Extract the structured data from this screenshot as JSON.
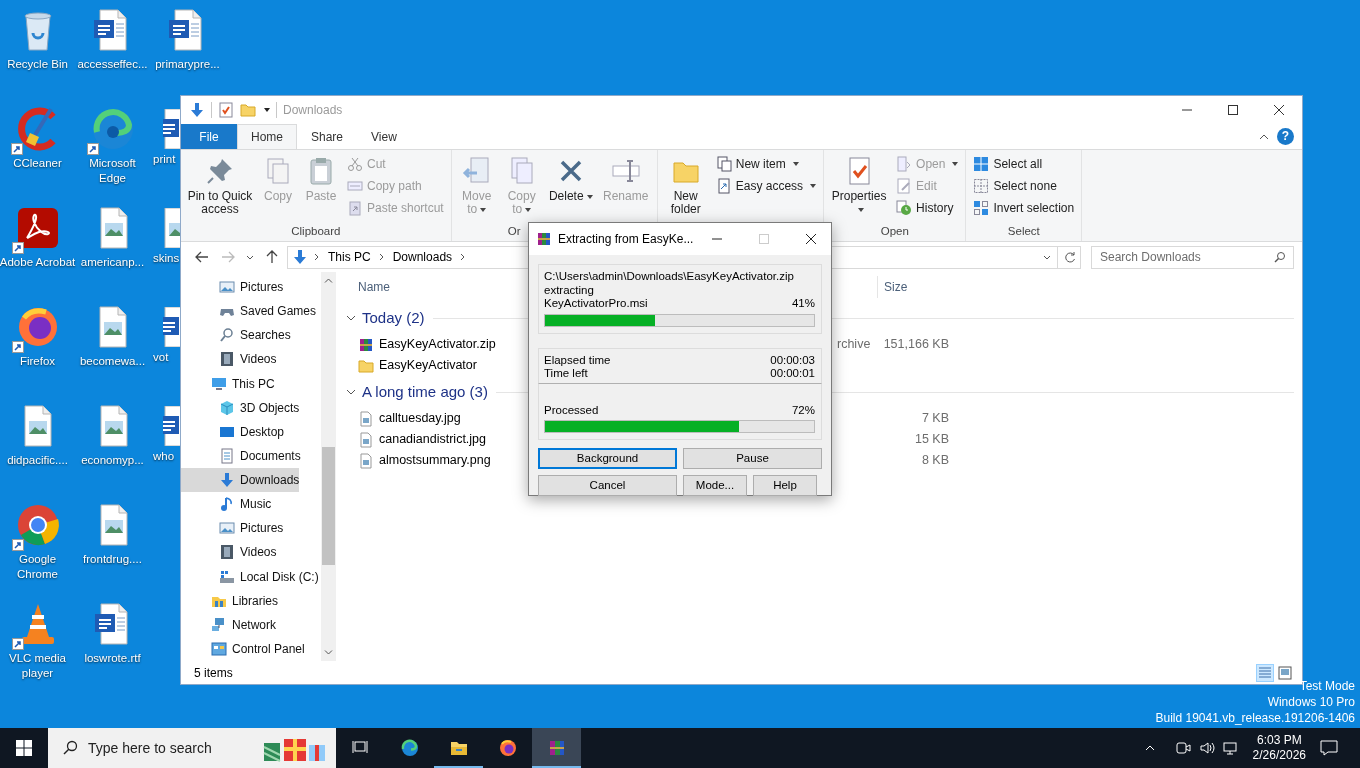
{
  "desktop": {
    "icons": [
      {
        "label": "Recycle Bin",
        "kind": "bin",
        "shortcut": false
      },
      {
        "label": "CCleaner",
        "kind": "ccleaner",
        "shortcut": true
      },
      {
        "label": "Adobe Acrobat",
        "kind": "acrobat",
        "shortcut": true
      },
      {
        "label": "Firefox",
        "kind": "firefox",
        "shortcut": true
      },
      {
        "label": "didpacific....",
        "kind": "image",
        "shortcut": false
      },
      {
        "label": "Google Chrome",
        "kind": "chrome",
        "shortcut": true
      },
      {
        "label": "VLC media player",
        "kind": "vlc",
        "shortcut": true
      },
      {
        "label": "accesseffec...",
        "kind": "word",
        "shortcut": false
      },
      {
        "label": "Microsoft Edge",
        "kind": "edge",
        "shortcut": true
      },
      {
        "label": "americanp...",
        "kind": "image",
        "shortcut": false
      },
      {
        "label": "becomewa...",
        "kind": "image",
        "shortcut": false
      },
      {
        "label": "economyp...",
        "kind": "image",
        "shortcut": false
      },
      {
        "label": "frontdrug....",
        "kind": "image",
        "shortcut": false
      },
      {
        "label": "loswrote.rtf",
        "kind": "word",
        "shortcut": false
      },
      {
        "label": "primarypre...",
        "kind": "word",
        "shortcut": false
      },
      {
        "label": "print",
        "kind": "word",
        "shortcut": false
      },
      {
        "label": "skins",
        "kind": "image",
        "shortcut": false
      },
      {
        "label": "vot",
        "kind": "word",
        "shortcut": false
      },
      {
        "label": "who",
        "kind": "word",
        "shortcut": false
      }
    ],
    "system_text": [
      "Test Mode",
      "Windows 10 Pro",
      "Build 19041.vb_release.191206-1406"
    ]
  },
  "explorer": {
    "title": "Downloads",
    "ribbon": {
      "tabs": [
        {
          "label": "File",
          "kind": "file",
          "selected": false
        },
        {
          "label": "Home",
          "kind": "tab",
          "selected": true
        },
        {
          "label": "Share",
          "kind": "tab",
          "selected": false
        },
        {
          "label": "View",
          "kind": "tab",
          "selected": false
        }
      ],
      "help": "?",
      "groups": [
        {
          "label": "Clipboard",
          "items": [
            {
              "label": "Pin to Quick access",
              "kind": "large",
              "disabled": false,
              "dropdown": false
            },
            {
              "label": "Copy",
              "kind": "large",
              "disabled": true,
              "dropdown": false
            },
            {
              "label": "Paste",
              "kind": "large",
              "disabled": true,
              "dropdown": false
            },
            {
              "label": "Cut",
              "kind": "small",
              "disabled": true,
              "dropdown": false
            },
            {
              "label": "Copy path",
              "kind": "small",
              "disabled": true,
              "dropdown": false
            },
            {
              "label": "Paste shortcut",
              "kind": "small",
              "disabled": true,
              "dropdown": false
            }
          ]
        },
        {
          "label": "Or",
          "items": [
            {
              "label": "Move to",
              "kind": "large",
              "disabled": true,
              "dropdown": true
            },
            {
              "label": "Copy to",
              "kind": "large",
              "disabled": true,
              "dropdown": true
            },
            {
              "label": "Delete",
              "kind": "large",
              "disabled": false,
              "dropdown": true
            },
            {
              "label": "Rename",
              "kind": "large",
              "disabled": true,
              "dropdown": false
            }
          ]
        },
        {
          "items": [
            {
              "label": "New folder",
              "kind": "large",
              "disabled": false,
              "dropdown": false
            },
            {
              "label": "New item",
              "kind": "small",
              "disabled": false,
              "dropdown": true
            },
            {
              "label": "Easy access",
              "kind": "small",
              "disabled": false,
              "dropdown": true
            }
          ]
        },
        {
          "label": "Open",
          "items": [
            {
              "label": "Properties",
              "kind": "large",
              "disabled": false,
              "dropdown": true
            },
            {
              "label": "Open",
              "kind": "small",
              "disabled": true,
              "dropdown": true
            },
            {
              "label": "Edit",
              "kind": "small",
              "disabled": true,
              "dropdown": false
            },
            {
              "label": "History",
              "kind": "small",
              "disabled": false,
              "dropdown": false
            }
          ]
        },
        {
          "label": "Select",
          "items": [
            {
              "label": "Select all",
              "kind": "small",
              "disabled": false,
              "dropdown": false
            },
            {
              "label": "Select none",
              "kind": "small",
              "disabled": false,
              "dropdown": false
            },
            {
              "label": "Invert selection",
              "kind": "small",
              "disabled": false,
              "dropdown": false
            }
          ]
        }
      ]
    },
    "address_bar": {
      "path": [
        "This PC",
        "Downloads"
      ]
    },
    "search": {
      "placeholder": "Search Downloads"
    },
    "nav_pane": {
      "continued_children": [
        {
          "label": "Pictures",
          "kind": "pictures",
          "selected": false
        },
        {
          "label": "Saved Games",
          "kind": "games",
          "selected": false
        },
        {
          "label": "Searches",
          "kind": "search",
          "selected": false
        },
        {
          "label": "Videos",
          "kind": "videos",
          "selected": false
        }
      ],
      "items": [
        {
          "label": "This PC",
          "kind": "pc",
          "selected": false,
          "children": [
            {
              "label": "3D Objects",
              "kind": "objects",
              "selected": false
            },
            {
              "label": "Desktop",
              "kind": "desktop",
              "selected": false
            },
            {
              "label": "Documents",
              "kind": "documents",
              "selected": false
            },
            {
              "label": "Downloads",
              "kind": "downloads",
              "selected": true
            },
            {
              "label": "Music",
              "kind": "music",
              "selected": false
            },
            {
              "label": "Pictures",
              "kind": "pictures",
              "selected": false
            },
            {
              "label": "Videos",
              "kind": "videos",
              "selected": false
            },
            {
              "label": "Local Disk (C:)",
              "kind": "disk",
              "selected": false
            }
          ]
        },
        {
          "label": "Libraries",
          "kind": "libraries",
          "selected": false
        },
        {
          "label": "Network",
          "kind": "network",
          "selected": false
        },
        {
          "label": "Control Panel",
          "kind": "control",
          "selected": false
        }
      ]
    },
    "columns": [
      "Name",
      "Size"
    ],
    "groups": [
      {
        "label": "Today (2)",
        "files": [
          {
            "name": "EasyKeyActivator.zip",
            "kind": "archive",
            "type": "rchive",
            "size": "151,166 KB"
          },
          {
            "name": "EasyKeyActivator",
            "kind": "folder"
          }
        ]
      },
      {
        "label": "A long time ago (3)",
        "files": [
          {
            "name": "calltuesday.jpg",
            "kind": "image",
            "size": "7 KB"
          },
          {
            "name": "canadiandistrict.jpg",
            "kind": "image",
            "size": "15 KB"
          },
          {
            "name": "almostsummary.png",
            "kind": "image",
            "size": "8 KB"
          }
        ]
      }
    ],
    "status_bar": {
      "text": "5 items",
      "view_buttons": [
        {
          "kind": "details",
          "selected": true
        },
        {
          "kind": "tiles",
          "selected": false
        }
      ]
    }
  },
  "dialog": {
    "title": "Extracting from EasyKe...",
    "archive_path": "C:\\Users\\admin\\Downloads\\EasyKeyActivator.zip",
    "action": "extracting",
    "current_file": "KeyActivatorPro.msi",
    "file_percent": "41%",
    "file_progress": {
      "level": 0.41
    },
    "stats": [
      {
        "label": "Elapsed time",
        "value": "00:00:03"
      },
      {
        "label": "Time left",
        "value": "00:00:01"
      }
    ],
    "total_label": "Processed",
    "total_percent": "72%",
    "total_progress": {
      "level": 0.72
    },
    "buttons": [
      {
        "label": "Background",
        "default": true
      },
      {
        "label": "Pause",
        "default": false
      },
      {
        "label": "Cancel",
        "default": false
      },
      {
        "label": "Mode...",
        "default": false
      },
      {
        "label": "Help",
        "default": false
      }
    ]
  },
  "taskbar": {
    "search": {
      "placeholder": "Type here to search"
    },
    "apps": [
      {
        "kind": "taskview",
        "running": false,
        "selected": false
      },
      {
        "kind": "edge",
        "running": false,
        "selected": false
      },
      {
        "kind": "explorer",
        "running": true,
        "selected": false
      },
      {
        "kind": "firefox",
        "running": false,
        "selected": false
      },
      {
        "kind": "winrar",
        "running": true,
        "selected": true
      }
    ],
    "clock": {
      "time": "6:03 PM",
      "date": "2/26/2026"
    }
  }
}
